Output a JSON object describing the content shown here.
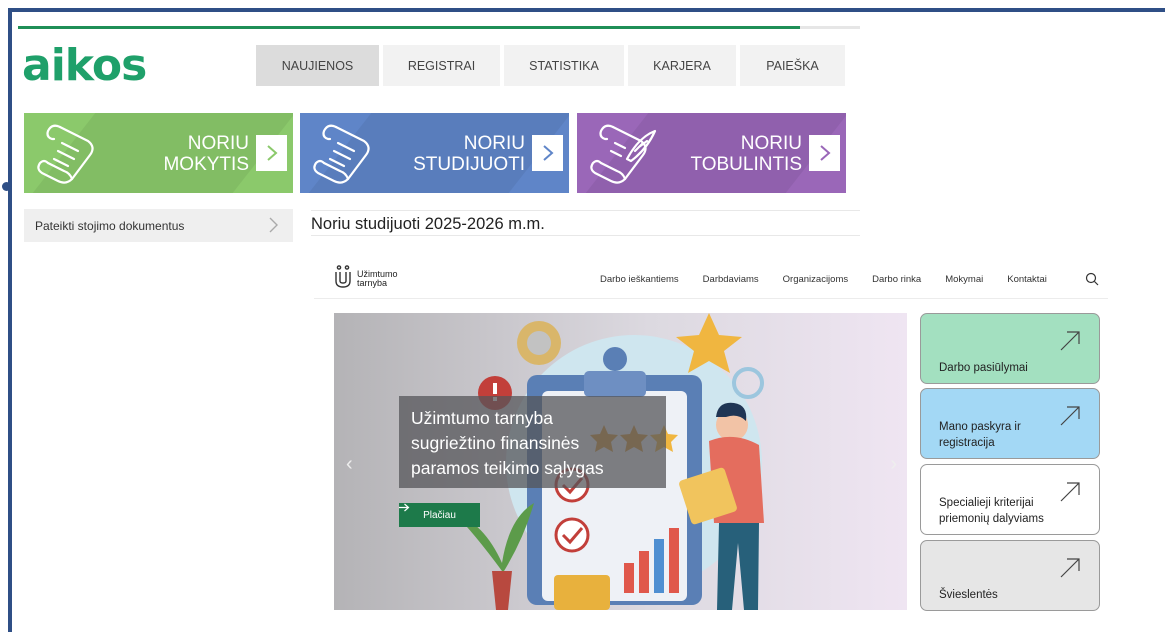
{
  "logo": "aikos",
  "nav": {
    "tabs": [
      {
        "label": "NAUJIENOS",
        "active": true
      },
      {
        "label": "REGISTRAI",
        "active": false
      },
      {
        "label": "STATISTIKA",
        "active": false
      },
      {
        "label": "KARJERA",
        "active": false
      },
      {
        "label": "PAIEŠKA",
        "active": false
      }
    ]
  },
  "tiles": [
    {
      "line1": "NORIU",
      "line2": "MOKYTIS",
      "color": "#8bc96b",
      "icon": "scroll-icon"
    },
    {
      "line1": "NORIU",
      "line2": "STUDIJUOTI",
      "color": "#5f85c8",
      "icon": "scroll-icon"
    },
    {
      "line1": "NORIU",
      "line2": "TOBULINTIS",
      "color": "#9a67b8",
      "icon": "scroll-quill-icon"
    }
  ],
  "sidebar": {
    "item": "Pateikti stojimo dokumentus"
  },
  "section": {
    "title": "Noriu studijuoti 2025-2026 m.m."
  },
  "embed": {
    "brand_line1": "Užimtumo",
    "brand_line2": "tarnyba",
    "nav": [
      "Darbo ieškantiems",
      "Darbdaviams",
      "Organizacijoms",
      "Darbo rinka",
      "Mokymai",
      "Kontaktai"
    ],
    "hero": {
      "caption_line1": "Užimtumo tarnyba",
      "caption_line2": "sugriežtino finansinės",
      "caption_line3": "paramos teikimo sąlygas",
      "button": "Plačiau"
    },
    "cards": [
      {
        "line1": "Darbo pasiūlymai",
        "line2": "",
        "color": "#a3e0c0"
      },
      {
        "line1": "Mano paskyra ir",
        "line2": "registracija",
        "color": "#a3d8f5"
      },
      {
        "line1": "Specialieji kriterijai",
        "line2": "priemonių dalyviams",
        "color": "#ffffff"
      },
      {
        "line1": "Švieslentės",
        "line2": "",
        "color": "#e6e6e6"
      }
    ]
  },
  "colors": {
    "frame": "#2f4f86",
    "logo": "#1fa06a",
    "accent": "#1d7a4a"
  }
}
